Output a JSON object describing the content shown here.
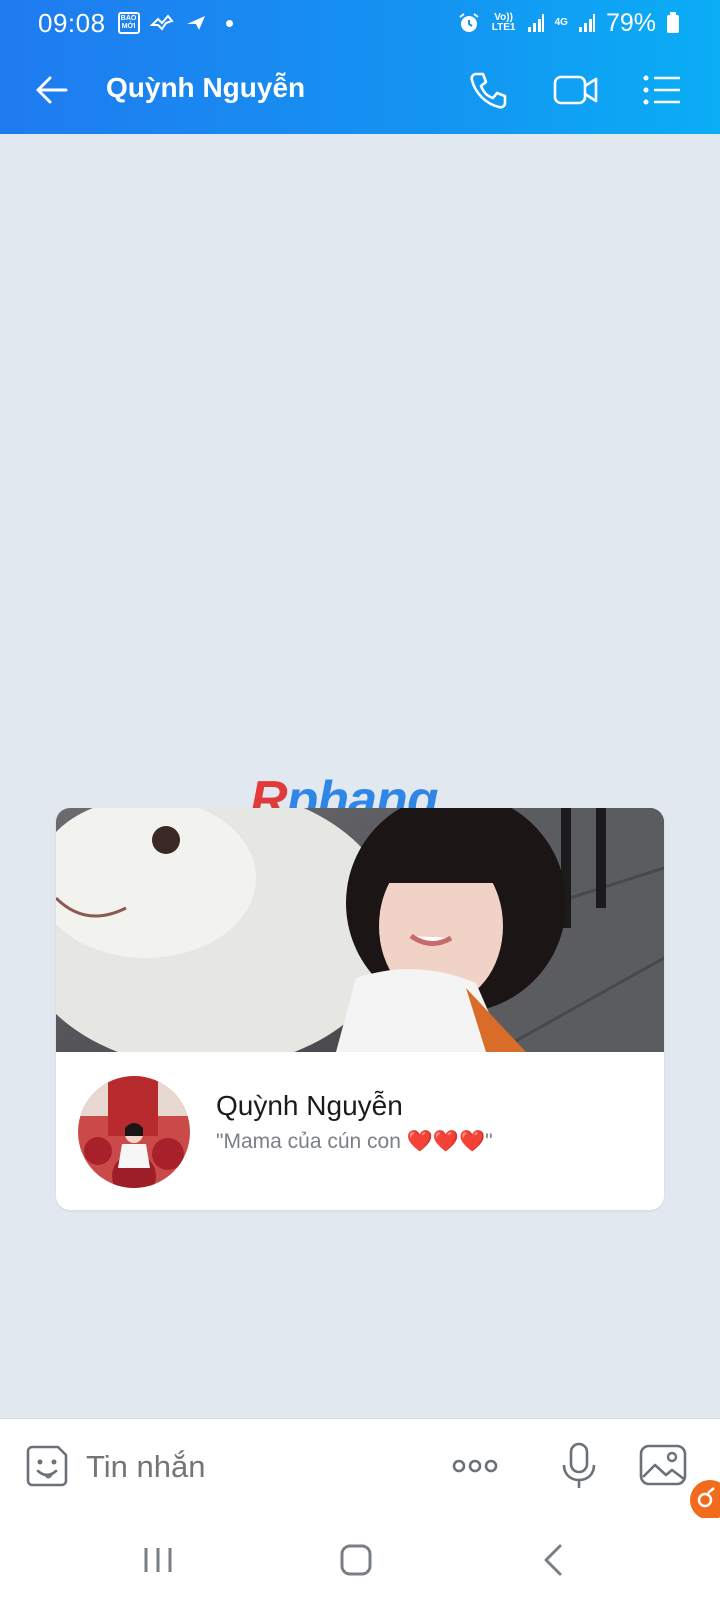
{
  "status_bar": {
    "time": "09:08",
    "app_badge": "BÁO MỚI",
    "volte_label": "Vo)) LTE1",
    "network_label": "4G",
    "battery": "79%"
  },
  "header": {
    "title": "Quỳnh Nguyễn",
    "icons": [
      "back-arrow-icon",
      "phone-icon",
      "video-call-icon",
      "menu-list-icon"
    ]
  },
  "watermark": {
    "first": "R",
    "rest": "phang"
  },
  "profile_card": {
    "name": "Quỳnh Nguyễn",
    "status": "\"Mama của cún con ❤️❤️❤️\""
  },
  "input_bar": {
    "placeholder": "Tin nhắn",
    "icons": [
      "sticker-icon",
      "more-icon",
      "microphone-icon",
      "image-icon"
    ]
  },
  "nav_bar": {
    "icons": [
      "recent-apps-icon",
      "home-icon",
      "back-icon"
    ]
  },
  "colors": {
    "header_start": "#1f7bf0",
    "header_end": "#0aaef5",
    "chat_background": "#e2e8f0",
    "badge": "#f26a1b"
  }
}
